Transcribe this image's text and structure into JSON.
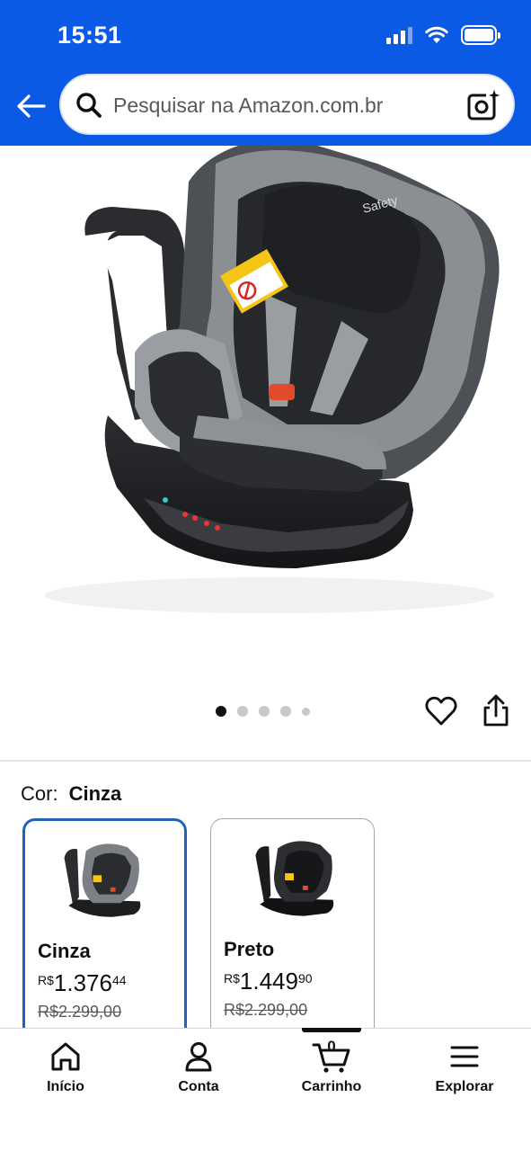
{
  "status_bar": {
    "time": "15:51"
  },
  "search": {
    "placeholder": "Pesquisar na Amazon.com.br"
  },
  "gallery": {
    "image_count": 5,
    "active_index": 0
  },
  "color_selector": {
    "label": "Cor:",
    "selected_value": "Cinza",
    "variants": [
      {
        "name": "Cinza",
        "currency": "R$",
        "price_int": "1.376",
        "price_cents": "44",
        "list_price": "R$2.299,00",
        "selected": true
      },
      {
        "name": "Preto",
        "currency": "R$",
        "price_int": "1.449",
        "price_cents": "90",
        "list_price": "R$2.299,00",
        "selected": false
      }
    ]
  },
  "bottom_nav": {
    "items": [
      {
        "label": "Início",
        "icon": "home-icon"
      },
      {
        "label": "Conta",
        "icon": "account-icon"
      },
      {
        "label": "Carrinho",
        "icon": "cart-icon",
        "count": "0"
      },
      {
        "label": "Explorar",
        "icon": "menu-icon"
      }
    ]
  },
  "colors": {
    "header": "#0a5ae6",
    "selected_border": "#2163b8"
  }
}
